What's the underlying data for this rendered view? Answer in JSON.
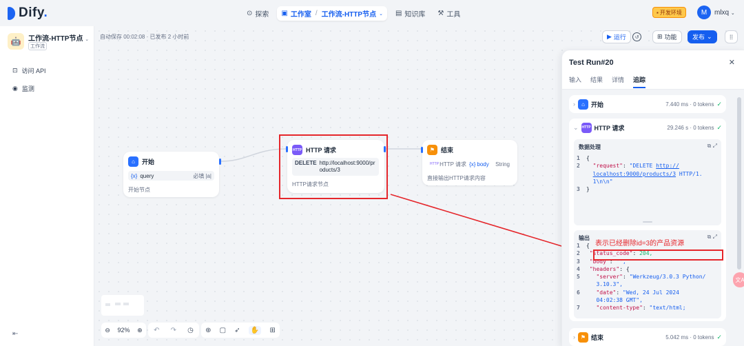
{
  "topbar": {
    "logo_text": "Dify",
    "nav": {
      "explore": "探索",
      "studio": "工作室",
      "current_app": "工作流-HTTP节点",
      "knowledge": "知识库",
      "tools": "工具"
    },
    "env_badge": "开发环境",
    "avatar_letter": "M",
    "user_name": "mlxq"
  },
  "sidebar": {
    "app_name": "工作流-HTTP节点",
    "app_type": "工作流",
    "items": [
      {
        "label": "访问 API"
      },
      {
        "label": "监测"
      }
    ]
  },
  "toolbar": {
    "autosave": "自动保存 00:02:08 · 已发布 2 小时前",
    "run_label": "运行",
    "features_label": "功能",
    "publish_label": "发布"
  },
  "nodes": {
    "start": {
      "title": "开始",
      "var_icon": "{x}",
      "var_name": "query",
      "var_required": "必填",
      "desc": "开始节点"
    },
    "http": {
      "title": "HTTP 请求",
      "method": "DELETE",
      "url": "http://localhost:9000/products/3",
      "desc": "HTTP请求节点"
    },
    "end": {
      "title": "结束",
      "var_source": "HTTP 请求",
      "var_icon": "{x}",
      "var_name": "body",
      "var_type": "String",
      "desc": "直接输出HTTP请求内容"
    }
  },
  "canvas_controls": {
    "zoom": "92%"
  },
  "panel": {
    "title": "Test Run#20",
    "tabs": [
      "输入",
      "结果",
      "详情",
      "追踪"
    ],
    "traces": [
      {
        "name": "开始",
        "meta": "7.440 ms · 0 tokens"
      },
      {
        "name": "HTTP 请求",
        "meta": "29.246 s · 0 tokens"
      },
      {
        "name": "结束",
        "meta": "5.042 ms · 0 tokens"
      }
    ],
    "data_processing": {
      "title": "数据处理",
      "lines": [
        {
          "no": "1",
          "text": "{"
        },
        {
          "no": "2",
          "key": "\"request\"",
          "val": "\"DELETE ",
          "url1": "http://",
          "cont_url": "localhost:9000/products/3",
          "cont_rest": " HTTP/1.",
          "cont2": "1\\n\\n\""
        },
        {
          "no": "3",
          "text": "}"
        }
      ]
    },
    "output": {
      "title": "输出",
      "lines": [
        {
          "no": "1",
          "text": "{"
        },
        {
          "no": "2",
          "key": "\"status_code\"",
          "val": "204,"
        },
        {
          "no": "3",
          "key": "\"body\"",
          "val": "\"\","
        },
        {
          "no": "4",
          "key": "\"headers\"",
          "val": "{"
        },
        {
          "no": "5",
          "key": "\"server\"",
          "val": "\"Werkzeug/3.0.3 Python/",
          "cont": "3.10.3\","
        },
        {
          "no": "6",
          "key": "\"date\"",
          "val": "\"Wed, 24 Jul 2024",
          "cont": "04:02:38 GMT\","
        },
        {
          "no": "7",
          "key": "\"content-type\"",
          "val": "\"text/html;"
        }
      ]
    }
  },
  "annotation": "表示已经删除id=3的产品资源"
}
